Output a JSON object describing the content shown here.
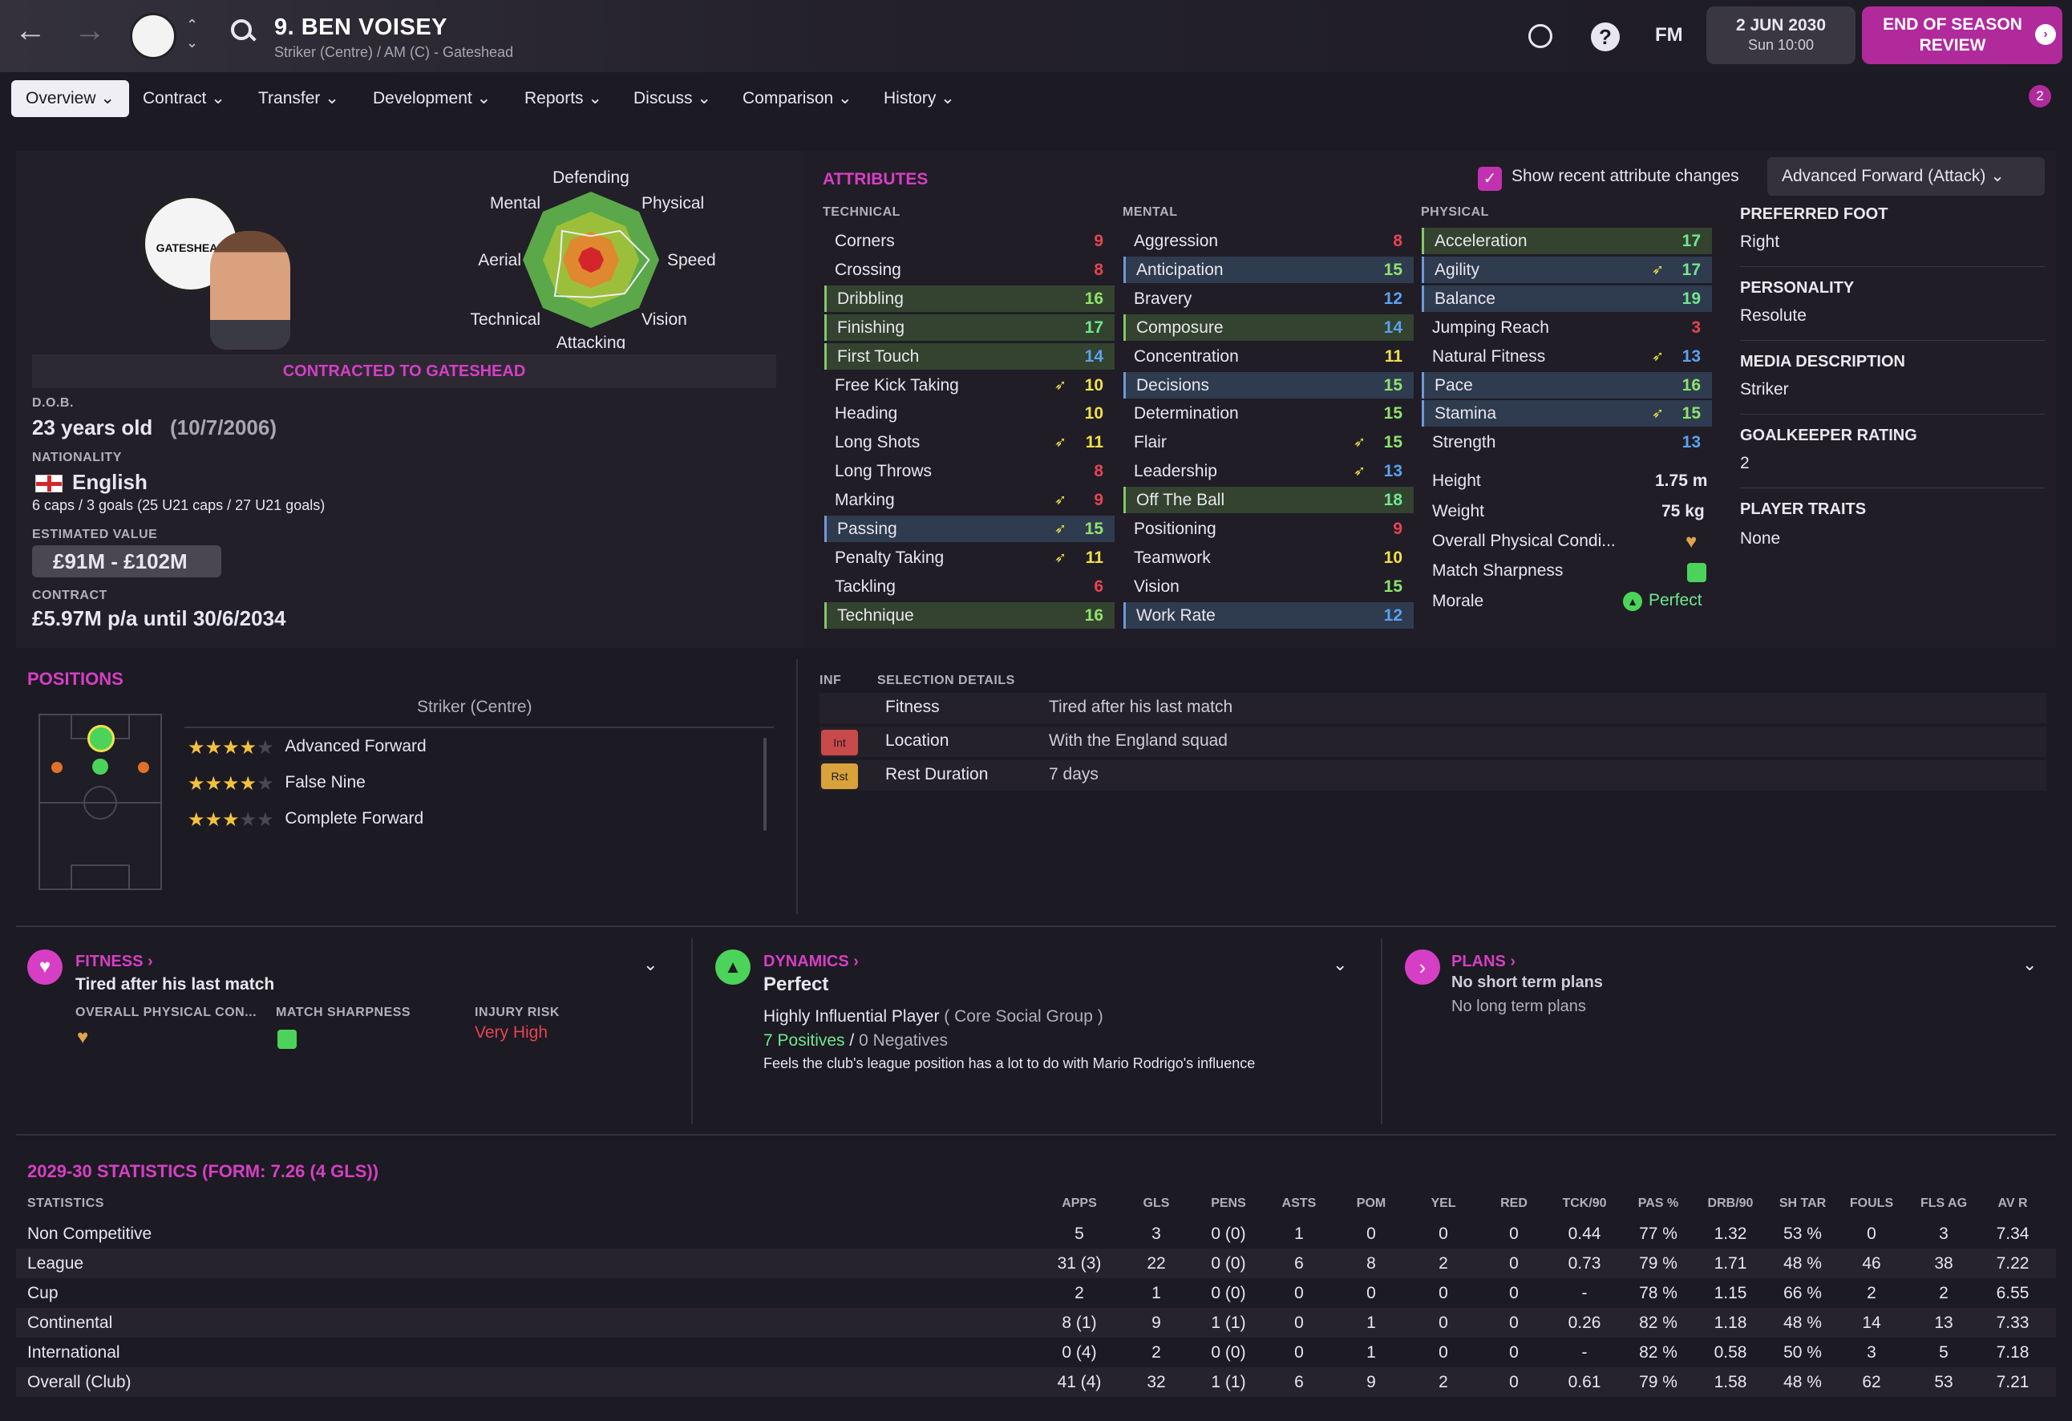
{
  "header": {
    "player_name": "9. BEN VOISEY",
    "subtitle": "Striker (Centre) / AM (C) - Gateshead",
    "date": "2 JUN 2030",
    "time": "Sun 10:00",
    "eos_line1": "END OF SEASON",
    "eos_line2": "REVIEW",
    "fm": "FM",
    "help": "?",
    "notif_count": "2"
  },
  "tabs": [
    "Overview",
    "Contract",
    "Transfer",
    "Development",
    "Reports",
    "Discuss",
    "Comparison",
    "History"
  ],
  "radar": {
    "labels": {
      "top": "Defending",
      "tr": "Physical",
      "r": "Speed",
      "br": "Vision",
      "bottom": "Attacking",
      "bl": "Technical",
      "l": "Aerial",
      "tl": "Mental"
    },
    "values": [
      0.35,
      0.6,
      0.85,
      0.7,
      0.55,
      0.75,
      0.45,
      0.6
    ]
  },
  "club_logo_text": "GATESHEAD",
  "contract_banner": "CONTRACTED TO GATESHEAD",
  "info": {
    "dob_label": "D.O.B.",
    "age": "23 years old",
    "dob": "(10/7/2006)",
    "nat_label": "NATIONALITY",
    "nationality": "English",
    "caps": "6 caps / 3 goals (25 U21 caps / 27 U21 goals)",
    "value_label": "ESTIMATED VALUE",
    "value": "£91M - £102M",
    "contract_label": "CONTRACT",
    "contract": "£5.97M p/a until 30/6/2034"
  },
  "attributes": {
    "title": "ATTRIBUTES",
    "show_changes": "Show recent attribute changes",
    "role": "Advanced Forward (Attack)",
    "tech_head": "TECHNICAL",
    "mental_head": "MENTAL",
    "phys_head": "PHYSICAL",
    "technical": [
      [
        "Corners",
        "9"
      ],
      [
        "Crossing",
        "8"
      ],
      [
        "Dribbling",
        "16"
      ],
      [
        "Finishing",
        "17"
      ],
      [
        "First Touch",
        "14"
      ],
      [
        "Free Kick Taking",
        "10"
      ],
      [
        "Heading",
        "10"
      ],
      [
        "Long Shots",
        "11"
      ],
      [
        "Long Throws",
        "8"
      ],
      [
        "Marking",
        "9"
      ],
      [
        "Passing",
        "15"
      ],
      [
        "Penalty Taking",
        "11"
      ],
      [
        "Tackling",
        "6"
      ],
      [
        "Technique",
        "16"
      ]
    ],
    "mental": [
      [
        "Aggression",
        "8"
      ],
      [
        "Anticipation",
        "15"
      ],
      [
        "Bravery",
        "12"
      ],
      [
        "Composure",
        "14"
      ],
      [
        "Concentration",
        "11"
      ],
      [
        "Decisions",
        "15"
      ],
      [
        "Determination",
        "15"
      ],
      [
        "Flair",
        "15"
      ],
      [
        "Leadership",
        "13"
      ],
      [
        "Off The Ball",
        "18"
      ],
      [
        "Positioning",
        "9"
      ],
      [
        "Teamwork",
        "10"
      ],
      [
        "Vision",
        "15"
      ],
      [
        "Work Rate",
        "12"
      ]
    ],
    "physical": [
      [
        "Acceleration",
        "17"
      ],
      [
        "Agility",
        "17"
      ],
      [
        "Balance",
        "19"
      ],
      [
        "Jumping Reach",
        "3"
      ],
      [
        "Natural Fitness",
        "13"
      ],
      [
        "Pace",
        "16"
      ],
      [
        "Stamina",
        "15"
      ],
      [
        "Strength",
        "13"
      ]
    ],
    "height_label": "Height",
    "height": "1.75 m",
    "weight_label": "Weight",
    "weight": "75 kg",
    "opc_label": "Overall Physical Condi...",
    "ms_label": "Match Sharpness",
    "morale_label": "Morale",
    "morale": "Perfect"
  },
  "side": {
    "foot_label": "PREFERRED FOOT",
    "foot": "Right",
    "pers_label": "PERSONALITY",
    "pers": "Resolute",
    "media_label": "MEDIA DESCRIPTION",
    "media": "Striker",
    "gk_label": "GOALKEEPER RATING",
    "gk": "2",
    "traits_label": "PLAYER TRAITS",
    "traits": "None"
  },
  "positions": {
    "title": "POSITIONS",
    "main": "Striker (Centre)",
    "roles": [
      {
        "name": "Advanced Forward",
        "stars": 3.5
      },
      {
        "name": "False Nine",
        "stars": 3.5
      },
      {
        "name": "Complete Forward",
        "stars": 3
      }
    ]
  },
  "selection": {
    "inf": "INF",
    "head": "SELECTION DETAILS",
    "rows": [
      {
        "badge": "",
        "k": "Fitness",
        "v": "Tired after his last match"
      },
      {
        "badge": "Int",
        "k": "Location",
        "v": "With the England squad"
      },
      {
        "badge": "Rst",
        "k": "Rest Duration",
        "v": "7 days"
      }
    ]
  },
  "fitness": {
    "title": "FITNESS",
    "status": "Tired after his last match",
    "opc": "OVERALL PHYSICAL CON...",
    "ms": "MATCH SHARPNESS",
    "ir": "INJURY RISK",
    "ir_val": "Very High"
  },
  "dynamics": {
    "title": "DYNAMICS",
    "status": "Perfect",
    "influence": "Highly Influential Player",
    "group": "( Core Social Group )",
    "pos": "7 Positives",
    "sep": "/",
    "neg": "0 Negatives",
    "note": "Feels the club's league position has a lot to do with Mario Rodrigo's influence"
  },
  "plans": {
    "title": "PLANS",
    "short": "No short term plans",
    "long": "No long term plans"
  },
  "stats": {
    "title": "2029-30 STATISTICS (FORM: 7.26 (4 GLS))",
    "col0": "STATISTICS",
    "headers": [
      "APPS",
      "GLS",
      "PENS",
      "ASTS",
      "POM",
      "YEL",
      "RED",
      "TCK/90",
      "PAS %",
      "DRB/90",
      "SH TAR",
      "FOULS",
      "FLS AG",
      "AV R"
    ],
    "rows": [
      [
        "Non Competitive",
        "5",
        "3",
        "0 (0)",
        "1",
        "0",
        "0",
        "0",
        "0.44",
        "77 %",
        "1.32",
        "53 %",
        "0",
        "3",
        "7.34"
      ],
      [
        "League",
        "31 (3)",
        "22",
        "0 (0)",
        "6",
        "8",
        "2",
        "0",
        "0.73",
        "79 %",
        "1.71",
        "48 %",
        "46",
        "38",
        "7.22"
      ],
      [
        "Cup",
        "2",
        "1",
        "0 (0)",
        "0",
        "0",
        "0",
        "0",
        "-",
        "78 %",
        "1.15",
        "66 %",
        "2",
        "2",
        "6.55"
      ],
      [
        "Continental",
        "8 (1)",
        "9",
        "1 (1)",
        "0",
        "1",
        "0",
        "0",
        "0.26",
        "82 %",
        "1.18",
        "48 %",
        "14",
        "13",
        "7.33"
      ],
      [
        "International",
        "0 (4)",
        "2",
        "0 (0)",
        "0",
        "1",
        "0",
        "0",
        "-",
        "82 %",
        "0.58",
        "50 %",
        "3",
        "5",
        "7.18"
      ],
      [
        "Overall (Club)",
        "41 (4)",
        "32",
        "1 (1)",
        "6",
        "9",
        "2",
        "0",
        "0.61",
        "79 %",
        "1.58",
        "48 %",
        "62",
        "53",
        "7.21"
      ]
    ]
  }
}
